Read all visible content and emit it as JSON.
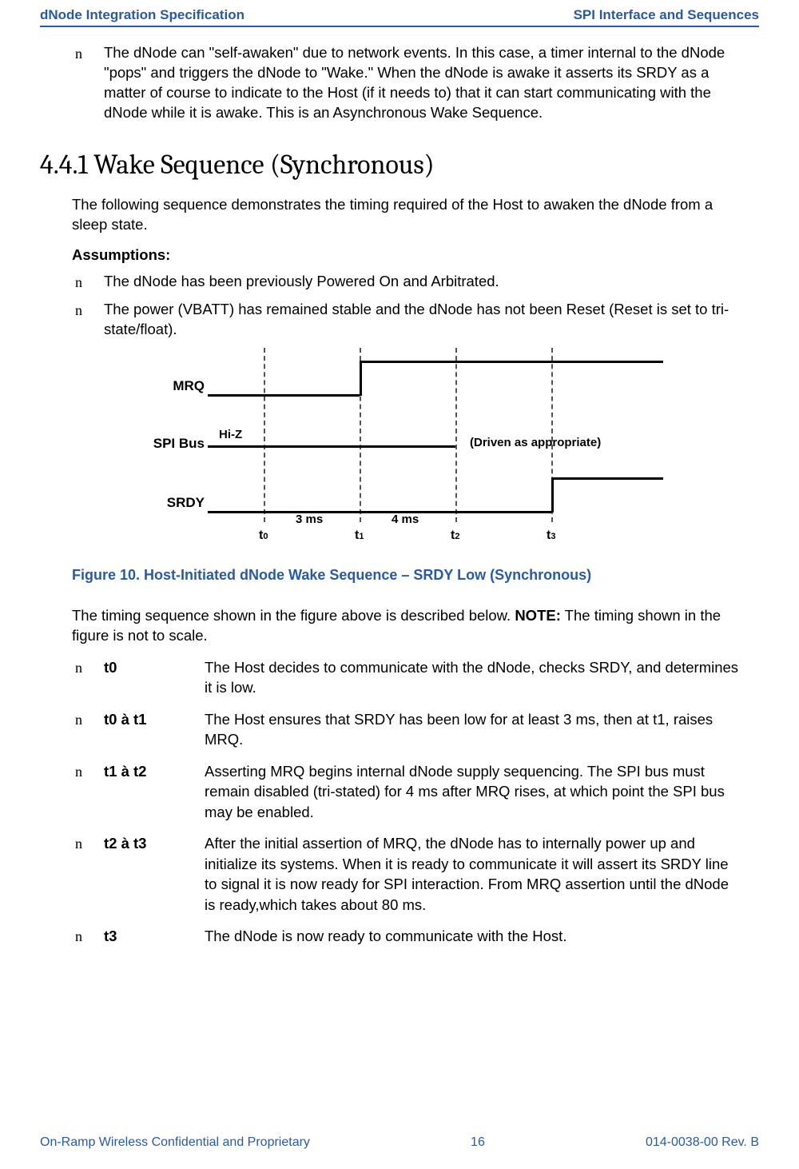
{
  "header": {
    "left": "dNode Integration Specification",
    "right": "SPI Interface and Sequences"
  },
  "intro_bullet": "The dNode can \"self-awaken\" due to network events. In this case, a timer internal to the dNode \"pops\" and triggers the dNode to \"Wake.\" When the dNode is awake it asserts its SRDY as a matter of course to indicate to the Host (if it needs to) that it can start communicating with the dNode while it is awake. This is an Asynchronous Wake Sequence.",
  "section": {
    "number": "4.4.1",
    "title": "Wake Sequence (Synchronous)"
  },
  "section_intro": "The following sequence demonstrates the timing required of the Host to awaken the dNode from a sleep state.",
  "assumptions_label": "Assumptions:",
  "assumptions": [
    "The dNode has been previously Powered On and Arbitrated.",
    "The power (VBATT) has remained stable and the dNode has not been Reset (Reset is set to tri-state/float)."
  ],
  "diagram": {
    "signals": {
      "mrq": "MRQ",
      "spi": "SPI Bus",
      "srdy": "SRDY"
    },
    "hiz": "Hi-Z",
    "driven": "(Driven as appropriate)",
    "d1": "3 ms",
    "d2": "4 ms",
    "ticks": {
      "t0": "t",
      "t0s": "0",
      "t1": "t",
      "t1s": "1",
      "t2": "t",
      "t2s": "2",
      "t3": "t",
      "t3s": "3"
    }
  },
  "figure_caption": "Figure 10. Host-Initiated dNode Wake Sequence – SRDY Low (Synchronous)",
  "after_figure_note_a": "The timing sequence shown in the figure above is described below. ",
  "after_figure_note_bold": "NOTE:",
  "after_figure_note_b": " The timing shown in the figure is not to scale.",
  "timing": [
    {
      "key": "t0",
      "desc": "The Host decides to communicate with the dNode, checks SRDY, and determines it is low."
    },
    {
      "key": "t0 à t1",
      "desc": "The Host ensures that SRDY has been low for at least 3 ms, then at t1, raises MRQ."
    },
    {
      "key": "t1 à t2",
      "desc": "Asserting MRQ begins internal dNode supply sequencing. The SPI bus must remain disabled (tri-stated) for 4 ms after MRQ rises, at which point the SPI bus may be enabled."
    },
    {
      "key": "t2 à t3",
      "desc": "After the initial assertion of MRQ, the dNode has to internally power up and initialize its systems. When it is ready to communicate it will assert its SRDY line to signal it is now ready for SPI interaction. From MRQ assertion until the dNode is ready,which takes about 80 ms."
    },
    {
      "key": "t3",
      "desc": "The dNode is now ready to communicate with the Host."
    }
  ],
  "footer": {
    "left": "On-Ramp Wireless Confidential and Proprietary",
    "center": "16",
    "right": "014-0038-00 Rev. B"
  }
}
